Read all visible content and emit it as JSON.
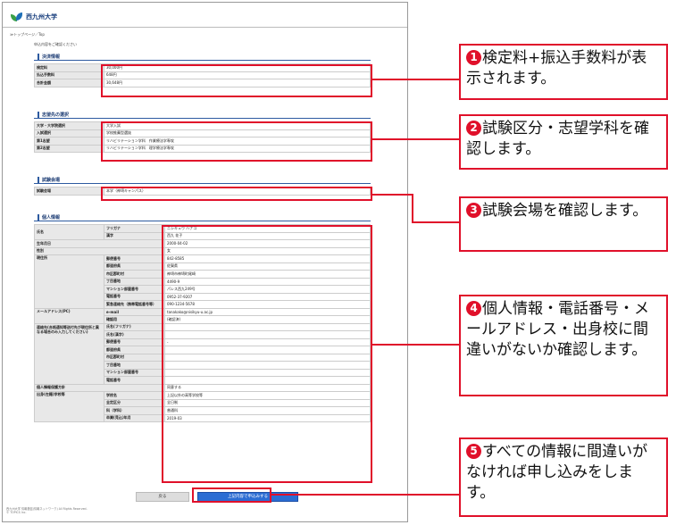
{
  "header": {
    "logo_text": "西九州大学",
    "breadcrumb": "≫トップページ／Top",
    "lead": "申込内容をご確認ください"
  },
  "payment": {
    "title": "決済情報",
    "rows": [
      [
        "検定料",
        "30,000円"
      ],
      [
        "払込手数料",
        "648円"
      ],
      [
        "合計金額",
        "30,648円"
      ]
    ]
  },
  "choice": {
    "title": "志望先の選択",
    "rows": [
      [
        "大学・大学院選択",
        "大学入試"
      ],
      [
        "入試選択",
        "学校推薦型選抜"
      ],
      [
        "第1志望",
        "リハビリテーション学科　作業療法学専攻"
      ],
      [
        "第2志望",
        "リハビリテーション学科　理学療法学専攻"
      ]
    ]
  },
  "venue": {
    "title": "試験会場",
    "rows": [
      [
        "試験会場",
        "本学（神埼キャンパス）"
      ]
    ]
  },
  "personal": {
    "title": "個人情報",
    "name_label": "氏名",
    "furigana_label": "フリガナ",
    "furigana": "ニシキュウ ハナコ",
    "kanji_label": "漢字",
    "kanji": "西九 花子",
    "birth_label": "生年月日",
    "birth": "2000-04-02",
    "sex_label": "性別",
    "sex": "女",
    "addr_label": "現住所",
    "addr_rows": [
      [
        "郵便番号",
        "842-8585"
      ],
      [
        "都道府県",
        "佐賀県"
      ],
      [
        "市区郡町村",
        "神埼市神埼町尾崎"
      ],
      [
        "丁目番地",
        "4490-9"
      ],
      [
        "マンション部屋番号",
        "パレス西九249号"
      ],
      [
        "電話番号",
        "0952-37-9207"
      ],
      [
        "緊急連絡先（携帯電話番号等）",
        "090-1234-5678"
      ]
    ],
    "mail_label": "メールアドレス(PC)",
    "mail_rows": [
      [
        "e-mail",
        "tanakako@nisikyu-u.ac.jp"
      ],
      [
        "確認用",
        "(確認済)"
      ]
    ],
    "contact_label": "連絡先(合格通知等送付先が現住所と異なる場合のみ入力してください)",
    "contact_rows": [
      [
        "氏名(フリガナ)",
        ""
      ],
      [
        "氏名(漢字)",
        ""
      ],
      [
        "郵便番号",
        "-"
      ],
      [
        "都道府県",
        ""
      ],
      [
        "市区郡町村",
        ""
      ],
      [
        "丁目番地",
        ""
      ],
      [
        "マンション部屋番号",
        ""
      ],
      [
        "電話番号",
        ""
      ]
    ],
    "policy_label": "個人情報保護方針",
    "policy": "同意する",
    "school_label": "出身(在籍)学校等",
    "school_rows": [
      [
        "学校名",
        "上記以外の高等学校等"
      ],
      [
        "全定区分",
        "全日制"
      ],
      [
        "科（学科）",
        "普通科"
      ],
      [
        "卒業(見込)年月",
        "2019-03"
      ]
    ]
  },
  "buttons": {
    "back": "戻る",
    "submit": "上記内容で申込みする"
  },
  "footer": "西九州大学 情報基盤(情報ネットワーク) All Rights Reserved.",
  "footer2": "© TOPICS Inc.",
  "callouts": [
    {
      "num": "1",
      "text": "検定料+振込手数料が表示されます。"
    },
    {
      "num": "2",
      "text": "試験区分・志望学科を確認します。"
    },
    {
      "num": "3",
      "text": "試験会場を確認します。"
    },
    {
      "num": "4",
      "text": "個人情報・電話番号・メールアドレス・出身校に間違いがないか確認します。"
    },
    {
      "num": "5",
      "text": "すべての情報に間違いがなければ申し込みをします。"
    }
  ],
  "colors": {
    "accent": "#e0102a",
    "button": "#2b6dd3",
    "section": "#2d5aa0"
  }
}
